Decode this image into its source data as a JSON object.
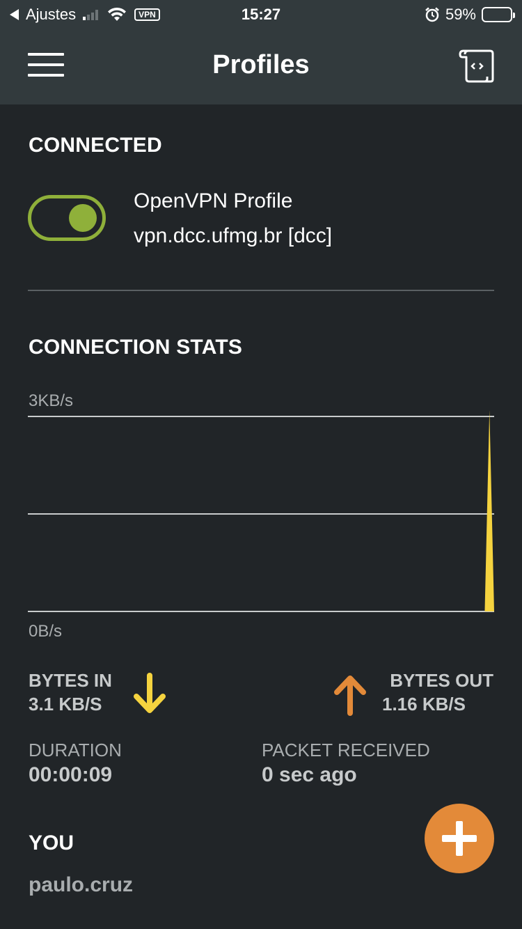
{
  "status_bar": {
    "back_app": "Ajustes",
    "vpn_badge": "VPN",
    "time": "15:27",
    "battery": "59%",
    "battery_level": 0.59
  },
  "app_bar": {
    "title": "Profiles"
  },
  "connected_section": {
    "title": "CONNECTED",
    "toggle_on": true,
    "profile_name": "OpenVPN Profile",
    "server": "vpn.dcc.ufmg.br [dcc]"
  },
  "stats_section": {
    "title": "CONNECTION STATS",
    "bytes_in_label": "BYTES IN",
    "bytes_in_value": "3.1 KB/S",
    "bytes_out_label": "BYTES OUT",
    "bytes_out_value": "1.16 KB/S",
    "duration_label": "DURATION",
    "duration_value": "00:00:09",
    "packet_label": "PACKET RECEIVED",
    "packet_value": "0 sec ago"
  },
  "chart_data": {
    "type": "area",
    "y_max_label": "3KB/s",
    "y_min_label": "0B/s",
    "ylim": [
      0,
      3
    ],
    "grid": true,
    "series": [
      {
        "values": [
          0,
          0,
          0,
          0,
          0,
          0,
          0,
          0,
          0,
          0,
          0,
          0,
          0,
          0,
          0,
          0,
          0,
          0,
          0,
          0,
          0,
          0,
          0,
          0,
          0,
          0,
          0,
          0,
          0,
          0,
          0,
          0,
          0,
          0,
          0,
          0,
          0,
          0,
          0,
          0,
          0,
          0,
          0,
          0,
          0,
          0,
          0,
          0,
          0,
          0,
          0,
          0,
          0,
          0,
          0,
          0,
          0,
          0,
          0,
          0,
          0,
          0,
          0,
          0,
          0,
          0,
          0,
          0,
          0,
          0,
          0,
          0,
          0,
          0,
          0,
          0,
          0,
          0,
          0,
          0,
          0,
          0,
          0,
          0,
          0,
          0,
          0,
          0,
          0,
          0,
          0,
          0,
          0,
          0,
          0,
          0,
          0,
          0,
          3.1,
          0
        ]
      }
    ],
    "colors": {
      "bytes_in": "#f5d33f",
      "bytes_out": "#e38a39"
    }
  },
  "you_section": {
    "title": "YOU",
    "username": "paulo.cruz"
  },
  "colors": {
    "background": "#212528",
    "app_bar": "#323a3d",
    "accent_green": "#8fb03a",
    "accent_orange": "#e38a39",
    "accent_yellow": "#f5d33f"
  },
  "icons": {
    "menu": "hamburger-menu-icon",
    "import": "import-profile-icon",
    "bytes_in": "arrow-down-icon",
    "bytes_out": "arrow-up-icon",
    "fab": "plus-icon"
  }
}
